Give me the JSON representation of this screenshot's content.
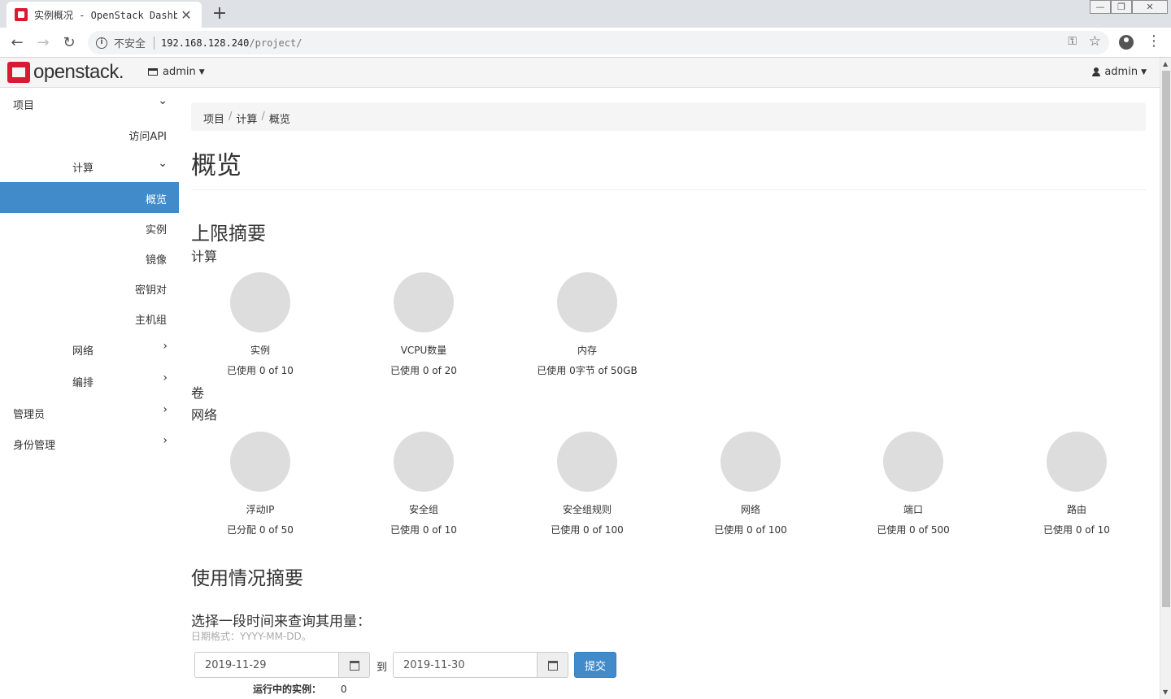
{
  "browser": {
    "tab_title": "实例概况 - OpenStack Dashboar",
    "tab_close": "✕",
    "new_tab": "+",
    "insecure_label": "不安全",
    "url_host": "192.168.128.240",
    "url_path": "/project/"
  },
  "header": {
    "logo_text": "openstack.",
    "project_label": "admin",
    "user_label": "admin"
  },
  "sidebar": {
    "items": [
      {
        "label": "项目",
        "level": 0,
        "chevron": "down"
      },
      {
        "label": "访问API",
        "level": 2
      },
      {
        "label": "计算",
        "level": 1,
        "chevron": "down"
      },
      {
        "label": "概览",
        "level": 2,
        "active": true
      },
      {
        "label": "实例",
        "level": 2
      },
      {
        "label": "镜像",
        "level": 2
      },
      {
        "label": "密钥对",
        "level": 2
      },
      {
        "label": "主机组",
        "level": 2
      },
      {
        "label": "网络",
        "level": 1,
        "chevron": "right"
      },
      {
        "label": "编排",
        "level": 1,
        "chevron": "right"
      },
      {
        "label": "管理员",
        "level": 0,
        "chevron": "right"
      },
      {
        "label": "身份管理",
        "level": 0,
        "chevron": "right"
      }
    ]
  },
  "main": {
    "breadcrumb": [
      "项目",
      "计算",
      "概览"
    ],
    "page_title": "概览",
    "limits_heading": "上限摘要",
    "compute_heading": "计算",
    "compute_pies": [
      {
        "name": "实例",
        "usage": "已使用 0 of 10",
        "used_fraction": 0
      },
      {
        "name": "VCPU数量",
        "usage": "已使用 0 of 20",
        "used_fraction": 0
      },
      {
        "name": "内存",
        "usage": "已使用 0字节 of 50GB",
        "used_fraction": 0
      }
    ],
    "volume_heading": "卷",
    "network_heading": "网络",
    "network_pies": [
      {
        "name": "浮动IP",
        "usage": "已分配 0 of 50",
        "used_fraction": 0
      },
      {
        "name": "安全组",
        "usage": "已使用 0 of 10",
        "used_fraction": 0
      },
      {
        "name": "安全组规则",
        "usage": "已使用 0 of 100",
        "used_fraction": 0
      },
      {
        "name": "网络",
        "usage": "已使用 0 of 100",
        "used_fraction": 0
      },
      {
        "name": "端口",
        "usage": "已使用 0 of 500",
        "used_fraction": 0
      },
      {
        "name": "路由",
        "usage": "已使用 0 of 10",
        "used_fraction": 0
      }
    ],
    "usage_heading": "使用情况摘要",
    "query_label": "选择一段时间来查询其用量：",
    "date_hint": "日期格式：YYYY-MM-DD。",
    "start_date": "2019-11-29",
    "to_label": "到",
    "end_date": "2019-11-30",
    "submit_label": "提交",
    "running_label": "运行中的实例：",
    "running_value": "0"
  },
  "colors": {
    "accent": "#428bca",
    "brand_red": "#da1a32",
    "pie_empty": "#dddddd"
  }
}
